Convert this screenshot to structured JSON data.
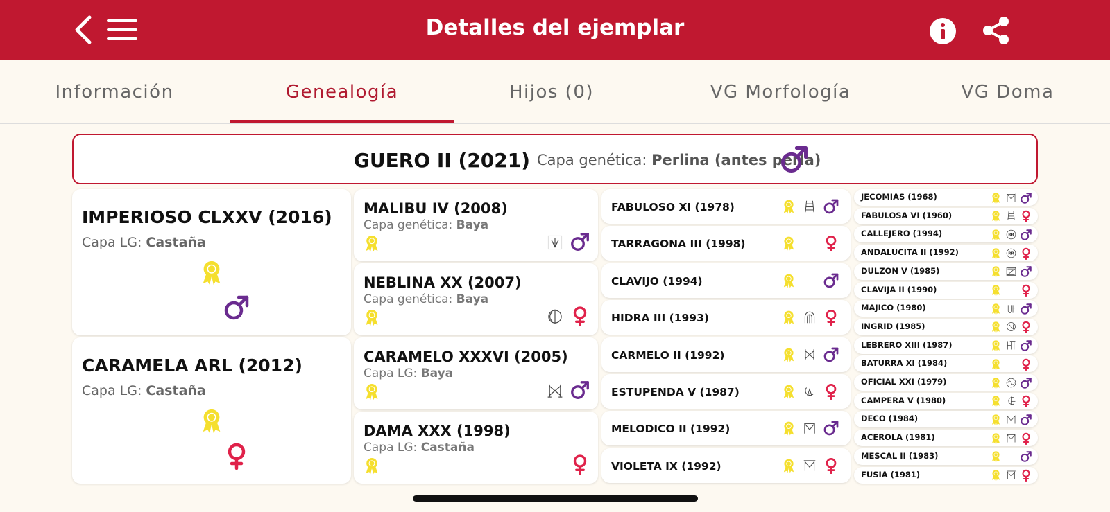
{
  "header": {
    "title": "Detalles del ejemplar"
  },
  "tabs": [
    {
      "label": "Información"
    },
    {
      "label": "Genealogía"
    },
    {
      "label": "Hijos (0)"
    },
    {
      "label": "VG Morfología"
    },
    {
      "label": "VG Doma"
    }
  ],
  "subject": {
    "name": "GUERO II (2021)",
    "capa_label": "Capa genética:",
    "capa_value": "Perlina (antes perla)",
    "sex": "male"
  },
  "gen1": [
    {
      "name": "IMPERIOSO CLXXV (2016)",
      "capa_label": "Capa LG:",
      "capa_value": "Castaña",
      "sex": "male"
    },
    {
      "name": "CARAMELA ARL (2012)",
      "capa_label": "Capa LG:",
      "capa_value": "Castaña",
      "sex": "female"
    }
  ],
  "gen2": [
    {
      "name": "MALIBU IV (2008)",
      "capa_label": "Capa genética:",
      "capa_value": "Baya",
      "sex": "male",
      "brand": "brand-a"
    },
    {
      "name": "NEBLINA XX (2007)",
      "capa_label": "Capa genética:",
      "capa_value": "Baya",
      "sex": "female",
      "brand": "brand-b"
    },
    {
      "name": "CARAMELO XXXVI (2005)",
      "capa_label": "Capa LG:",
      "capa_value": "Baya",
      "sex": "male",
      "brand": "brand-c"
    },
    {
      "name": "DAMA XXX (1998)",
      "capa_label": "Capa LG:",
      "capa_value": "Castaña",
      "sex": "female",
      "brand": ""
    }
  ],
  "gen3": [
    {
      "name": "FABULOSO XI (1978)",
      "sex": "male",
      "brand": "ladder"
    },
    {
      "name": "TARRAGONA III (1998)",
      "sex": "female",
      "brand": ""
    },
    {
      "name": "CLAVIJO (1994)",
      "sex": "male",
      "brand": ""
    },
    {
      "name": "HIDRA III (1993)",
      "sex": "female",
      "brand": "arch"
    },
    {
      "name": "CARMELO II (1992)",
      "sex": "male",
      "brand": "h"
    },
    {
      "name": "ESTUPENDA V (1987)",
      "sex": "female",
      "brand": "a"
    },
    {
      "name": "MELODICO II (1992)",
      "sex": "male",
      "brand": "m"
    },
    {
      "name": "VIOLETA IX (1992)",
      "sex": "female",
      "brand": "m2"
    }
  ],
  "gen4": [
    {
      "name": "JECOMIAS (1968)",
      "sex": "male",
      "brand": "m"
    },
    {
      "name": "FABULOSA VI (1960)",
      "sex": "female",
      "brand": "ladder"
    },
    {
      "name": "CALLEJERO (1994)",
      "sex": "male",
      "brand": "rr"
    },
    {
      "name": "ANDALUCITA II (1992)",
      "sex": "female",
      "brand": "rr"
    },
    {
      "name": "DULZON V (1985)",
      "sex": "male",
      "brand": "z"
    },
    {
      "name": "CLAVIJA II (1990)",
      "sex": "female",
      "brand": ""
    },
    {
      "name": "MAJICO (1980)",
      "sex": "male",
      "brand": "j"
    },
    {
      "name": "INGRID (1985)",
      "sex": "female",
      "brand": "n"
    },
    {
      "name": "LEBRERO XIII (1987)",
      "sex": "male",
      "brand": "h2"
    },
    {
      "name": "BATURRA XI (1984)",
      "sex": "female",
      "brand": ""
    },
    {
      "name": "OFICIAL XXI (1979)",
      "sex": "male",
      "brand": "oo"
    },
    {
      "name": "CAMPERA V (1980)",
      "sex": "female",
      "brand": "c"
    },
    {
      "name": "DECO (1984)",
      "sex": "male",
      "brand": "m"
    },
    {
      "name": "ACEROLA (1981)",
      "sex": "female",
      "brand": "m"
    },
    {
      "name": "MESCAL II (1983)",
      "sex": "male",
      "brand": ""
    },
    {
      "name": "FUSIA (1981)",
      "sex": "female",
      "brand": "m2"
    }
  ],
  "colors": {
    "brand_red": "#c01830",
    "male": "#6a2b8f",
    "female": "#e0224a",
    "award": "#f5df2e",
    "background": "#fdf9f1"
  },
  "icons": {
    "back": "chevron-left-icon",
    "menu": "hamburger-menu-icon",
    "info": "info-icon",
    "share": "share-icon",
    "award": "award-ribbon-icon",
    "male": "male-symbol-icon",
    "female": "female-symbol-icon"
  }
}
